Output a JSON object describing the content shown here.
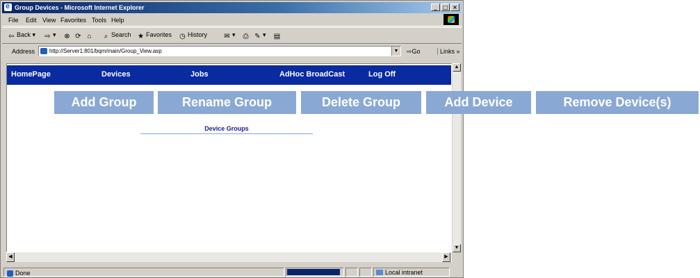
{
  "window": {
    "title": "Group Devices - Microsoft Internet Explorer",
    "buttons": [
      "_",
      "□",
      "×"
    ]
  },
  "menu": [
    "File",
    "Edit",
    "View",
    "Favorites",
    "Tools",
    "Help"
  ],
  "toolbar": {
    "back": "Back",
    "search": "Search",
    "favorites": "Favorites",
    "history": "History"
  },
  "address": {
    "label": "Address",
    "url": "http://Server1:801/bqm/main/Group_View.asp",
    "go": "Go",
    "links": "Links"
  },
  "nav": [
    "HomePage",
    "Devices",
    "Jobs",
    "AdHoc BroadCast",
    "Log Off"
  ],
  "actions": [
    "Add Group",
    "Rename Group",
    "Delete Group",
    "Add Device",
    "Remove Device(s)"
  ],
  "content": {
    "group_title": "Device Groups"
  },
  "status": {
    "text": "Done",
    "zone": "Local intranet",
    "progress": 0.95
  },
  "colors": {
    "navbar": "#0a2aa0",
    "action_button": "#8aa8d4",
    "titlebar": "#0a246a"
  }
}
